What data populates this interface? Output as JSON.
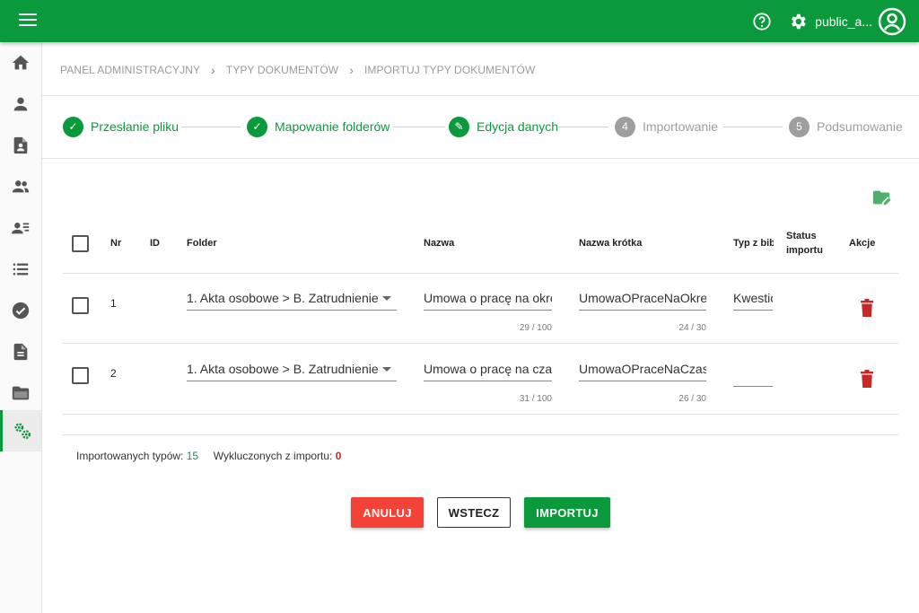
{
  "header": {
    "username": "public_a...",
    "accent_color": "#0a9a3c"
  },
  "sidebar": {
    "items": [
      {
        "icon": "home-icon"
      },
      {
        "icon": "person-icon"
      },
      {
        "icon": "document-person-icon"
      },
      {
        "icon": "people-icon"
      },
      {
        "icon": "person-list-icon"
      },
      {
        "icon": "list-icon"
      },
      {
        "icon": "check-circle-icon"
      },
      {
        "icon": "document-icon"
      },
      {
        "icon": "folder-open-icon"
      },
      {
        "icon": "settings-gears-icon",
        "active": true
      }
    ]
  },
  "breadcrumb": [
    "PANEL ADMINISTRACYJNY",
    "TYPY DOKUMENTÓW",
    "IMPORTUJ TYPY DOKUMENTÓW"
  ],
  "stepper": [
    {
      "label": "Przesłanie pliku",
      "state": "done",
      "marker": "✓"
    },
    {
      "label": "Mapowanie folderów",
      "state": "done",
      "marker": "✓"
    },
    {
      "label": "Edycja danych",
      "state": "done",
      "marker": "✎"
    },
    {
      "label": "Importowanie",
      "state": "todo",
      "marker": "4"
    },
    {
      "label": "Podsumowanie",
      "state": "todo",
      "marker": "5"
    }
  ],
  "table": {
    "headers": {
      "nr": "Nr",
      "id": "ID",
      "folder": "Folder",
      "nazwa": "Nazwa",
      "nazwa_krotka": "Nazwa krótka",
      "typ": "Typ z bib",
      "status_1": "Status",
      "status_2": "importu",
      "akcje": "Akcje"
    },
    "rows": [
      {
        "nr": "1",
        "id": "",
        "folder": "1. Akta osobowe > B. Zatrudnienie",
        "nazwa": "Umowa o pracę na okres próbny",
        "nazwa_counter": "29 / 100",
        "nazwa_krotka": "UmowaOPraceNaOkresProbny",
        "nazwa_krotka_counter": "24 / 30",
        "typ": "Kwestionariusz"
      },
      {
        "nr": "2",
        "id": "",
        "folder": "1. Akta osobowe > B. Zatrudnienie",
        "nazwa": "Umowa o pracę na czas określony",
        "nazwa_counter": "31 / 100",
        "nazwa_krotka": "UmowaOPraceNaCzasOkreslony",
        "nazwa_krotka_counter": "26 / 30",
        "typ": ""
      }
    ]
  },
  "summary": {
    "imported_label": "Importowanych typów:",
    "imported_value": "15",
    "excluded_label": "Wykluczonych z importu:",
    "excluded_value": "0"
  },
  "buttons": {
    "cancel": "ANULUJ",
    "back": "WSTECZ",
    "import": "IMPORTUJ"
  }
}
